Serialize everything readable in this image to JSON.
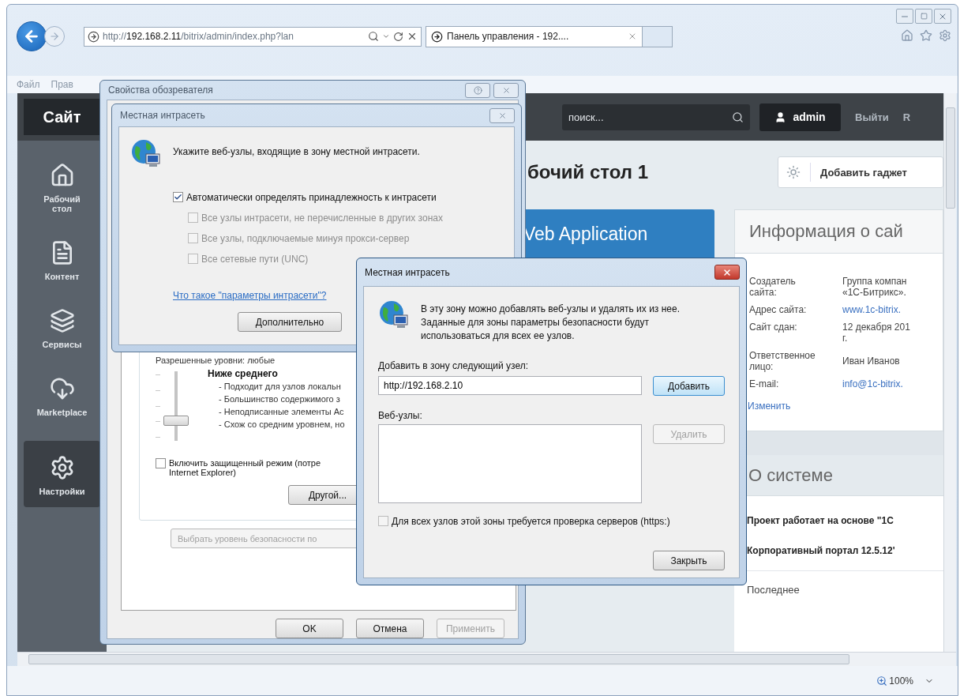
{
  "browser": {
    "address": "http://**192.168.2.11**/bitrix/admin/index.php?lan",
    "tabs": [
      {
        "label": "Панель управления - 192....",
        "selected": true
      }
    ],
    "menu": [
      "Файл",
      "Прав"
    ],
    "zoom": "100%"
  },
  "site": {
    "logo": "Сайт",
    "search": {
      "placeholder": "поиск..."
    },
    "user": "admin",
    "logout": "Выйти",
    "lang": "R",
    "nav": [
      {
        "label": "Рабочий\nстол",
        "selected": false
      },
      {
        "label": "Контент",
        "selected": false
      },
      {
        "label": "Сервисы",
        "selected": false
      },
      {
        "label": "Marketplace",
        "selected": false
      },
      {
        "label": "Настройки",
        "selected": true
      }
    ],
    "heading": "бочий стол 1",
    "add_gadget": "Добавить гаджет",
    "gadget_title": "Veb Application",
    "info": {
      "title": "Информация о сай",
      "rows": [
        {
          "label": "Создатель\nсайта:",
          "value": "Группа компан\n«1С-Битрикс».",
          "kind": "text"
        },
        {
          "label": "Адрес сайта:",
          "value": "www.1c-bitrix.",
          "kind": "link"
        },
        {
          "label": "Сайт сдан:",
          "value": "12 декабря 201\nг.",
          "kind": "text"
        },
        {
          "label": "Ответственное\nлицо:",
          "value": "Иван Иванов",
          "kind": "text"
        },
        {
          "label": "E-mail:",
          "value": "info@1c-bitrix.",
          "kind": "link"
        }
      ],
      "edit": "Изменить"
    },
    "system": {
      "title": "О системе",
      "lines": [
        "Проект работает на основе \"1С",
        "Корпоративный портал 12.5.12'"
      ],
      "last_update": "Последнее"
    }
  },
  "properties_dialog": {
    "title": "Свойства обозревателя",
    "allowed_levels": "Разрешенные уровни: любые",
    "level_name": "Ниже среднего",
    "slider": {
      "level": 0.25
    },
    "bullets": [
      "- Подходит для узлов локальн",
      "- Большинство содержимого з",
      "- Неподписанные элементы Ac",
      "- Схож со средним уровнем, но"
    ],
    "protected_mode": {
      "label": "Включить защищенный режим (потре\nInternet Explorer)",
      "checked": false
    },
    "custom_button": "Другой...",
    "default_button": {
      "label": "Выбрать уровень безопасности по",
      "disabled": true
    },
    "buttons": [
      {
        "label": "OK",
        "disabled": false
      },
      {
        "label": "Отмена",
        "disabled": false
      },
      {
        "label": "Применить",
        "disabled": true
      }
    ]
  },
  "intranet_dialog": {
    "title": "Местная интрасеть",
    "prompt": "Укажите веб-узлы, входящие в зону местной интрасети.",
    "options": [
      {
        "label": "Автоматически определять принадлежность к интрасети",
        "checked": true,
        "disabled": false,
        "children": [
          {
            "label": "Все узлы интрасети, не перечисленные в других зонах",
            "checked": false,
            "disabled": true
          },
          {
            "label": "Все узлы, подключаемые минуя прокси-сервер",
            "checked": false,
            "disabled": true
          },
          {
            "label": "Все сетевые пути (UNC)",
            "checked": false,
            "disabled": true
          }
        ]
      }
    ],
    "link": "Что такое \"параметры интрасети\"?",
    "advanced_button": "Дополнительно"
  },
  "sites_dialog": {
    "title": "Местная интрасеть",
    "description": "В эту зону можно добавлять веб-узлы и удалять их из нее.\nЗаданные для зоны параметры безопасности будут\nиспользоваться для всех ее узлов.",
    "add_label": "Добавить в зону следующий узел:",
    "add_value": "http://192.168.2.10",
    "add_button": {
      "label": "Добавить",
      "default": true
    },
    "list_label": "Веб-узлы:",
    "remove_button": {
      "label": "Удалить",
      "disabled": true
    },
    "require_https": {
      "label": "Для всех узлов этой зоны требуется проверка серверов (https:)",
      "checked": false
    },
    "close_button": "Закрыть"
  }
}
